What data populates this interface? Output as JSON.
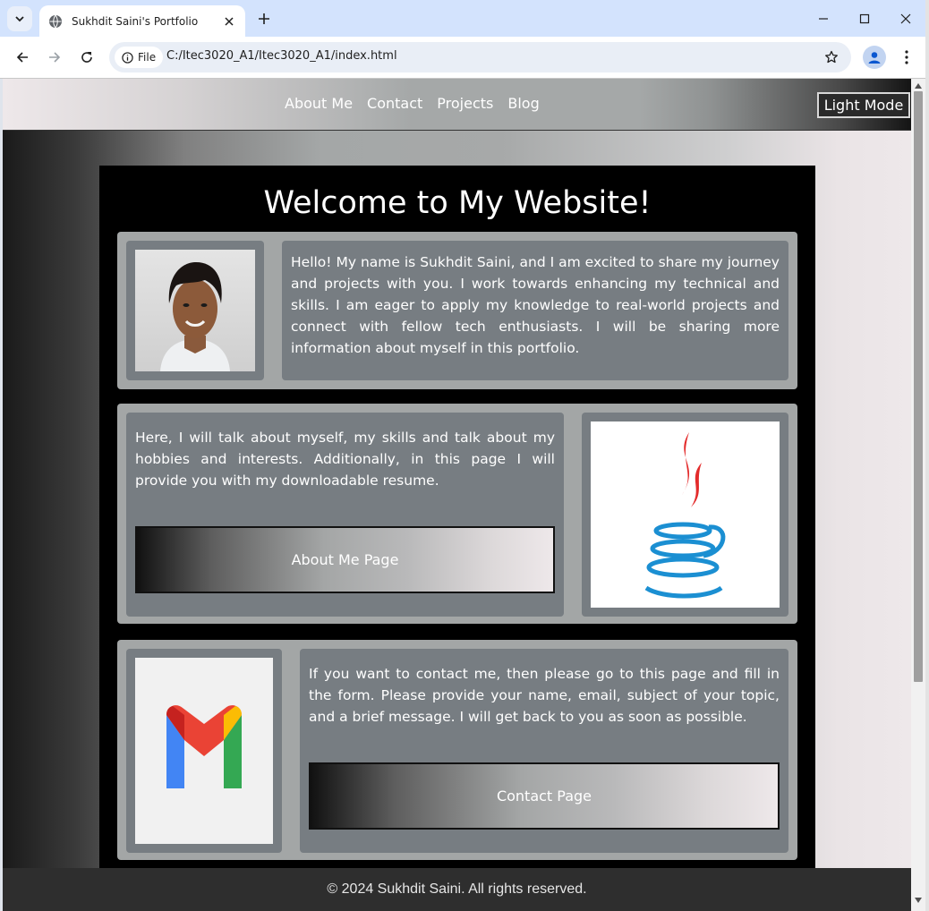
{
  "browser": {
    "tab_title": "Sukhdit Saini's Portfolio",
    "site_chip_label": "File",
    "url": "C:/Itec3020_A1/Itec3020_A1/index.html"
  },
  "nav": {
    "links": [
      "About Me",
      "Contact",
      "Projects",
      "Blog"
    ],
    "mode_button": "Light Mode"
  },
  "main": {
    "title": "Welcome to My Website!",
    "intro_text": "Hello! My name is Sukhdit Saini, and I am excited to share my journey and projects with you. I work towards enhancing my technical and skills. I am eager to apply my knowledge to real-world projects and connect with fellow tech enthusiasts. I will be sharing more information about myself in this portfolio.",
    "about_text": "Here, I will talk about myself, my skills and talk about my hobbies and interests. Additionally, in this page I will provide you with my downloadable resume.",
    "about_button": "About Me Page",
    "contact_text": "If you want to contact me, then please go to this page and fill in the form. Please provide your name, email, subject of your topic, and a brief message. I will get back to you as soon as possible.",
    "contact_button": "Contact Page"
  },
  "footer": {
    "text": "© 2024 Sukhdit Saini. All rights reserved."
  }
}
